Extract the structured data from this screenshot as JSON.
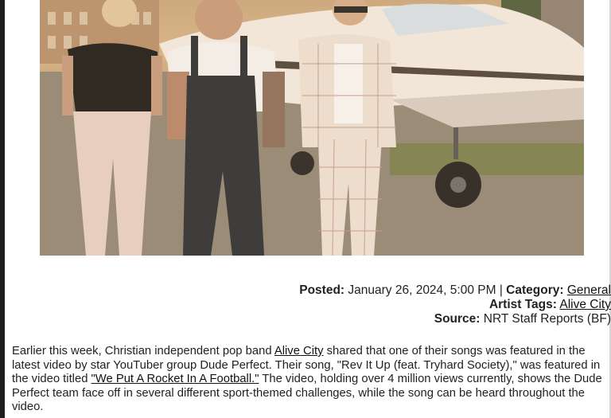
{
  "photo": {
    "alt_subject": "band-with-airplane"
  },
  "meta": {
    "posted_label": "Posted:",
    "posted_value": "January 26, 2024, 5:00 PM",
    "separator": "|",
    "category_label": "Category:",
    "category_link": "General",
    "artist_tags_label": "Artist Tags:",
    "artist_tags_link": "Alive City",
    "source_label": "Source:",
    "source_value": "NRT Staff Reports (BF)"
  },
  "article": {
    "p1_a": "Earlier this week, Christian independent pop band ",
    "p1_link": "Alive City",
    "p1_b": " shared that one of their songs was featured in the latest video by star YouTuber group Dude Perfect. Their song, \"Rev It Up (feat. Tryhard Society),\" was featured in the video titled ",
    "p1_video_link": "\"We Put A Rocket In A Football.\"",
    "p1_c": " The video, holding over 4 million views currently, shows the Dude Perfect team face off in several different sport-themed challenges, while the song can be heard throughout the video."
  },
  "colors": {
    "text": "#222222",
    "link": "#111111",
    "background": "#ffffff"
  }
}
